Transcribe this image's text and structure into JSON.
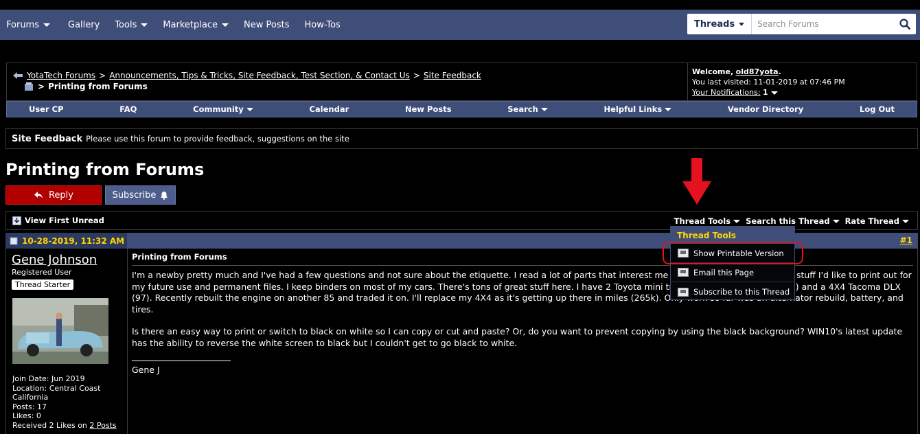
{
  "topnav": {
    "items": [
      {
        "label": "Forums",
        "dropdown": true
      },
      {
        "label": "Gallery",
        "dropdown": false
      },
      {
        "label": "Tools",
        "dropdown": true
      },
      {
        "label": "Marketplace",
        "dropdown": true
      },
      {
        "label": "New Posts",
        "dropdown": false
      },
      {
        "label": "How-Tos",
        "dropdown": false
      }
    ],
    "search_scope": "Threads",
    "search_placeholder": "Search Forums"
  },
  "breadcrumb": {
    "items": [
      "YotaTech Forums",
      "Announcements, Tips & Tricks, Site Feedback, Test Section, & Contact Us",
      "Site Feedback"
    ],
    "separator": ">",
    "current": "Printing from Forums"
  },
  "userbox": {
    "welcome": "Welcome,",
    "username": "old87yota",
    "last_visited": "You last visited: 11-01-2019 at 07:46 PM",
    "notifications_label": "Your Notifications:",
    "notifications_count": "1"
  },
  "subnav": {
    "items": [
      "User CP",
      "FAQ",
      "Community",
      "Calendar",
      "New Posts",
      "Search",
      "Helpful Links",
      "Vendor Directory",
      "Log Out"
    ]
  },
  "forum": {
    "name": "Site Feedback",
    "description": "Please use this forum to provide feedback, suggestions on the site"
  },
  "thread": {
    "title": "Printing from Forums",
    "reply_label": "Reply",
    "subscribe_label": "Subscribe"
  },
  "toolbar": {
    "view_first_unread": "View First Unread",
    "thread_tools": "Thread Tools",
    "search_thread": "Search this Thread",
    "rate_thread": "Rate Thread"
  },
  "dropdown": {
    "title": "Thread Tools",
    "items": [
      "Show Printable Version",
      "Email this Page",
      "Subscribe to this Thread"
    ]
  },
  "post": {
    "date": "10-28-2019, 11:32 AM",
    "number": "#1",
    "subject": "Printing from Forums",
    "paragraphs": [
      "I'm a newby pretty much and I've had a few questions and not sure about the etiquette. I read a lot of parts that interest me and sometimes come across stuff I'd like to print out for my future use and permanent files. I keep binders on most of my cars. There's tons of great stuff here. I have 2 Toyota mini trucks- one's a Dolphin RV (85) and a 4X4 Tacoma DLX (97). Recently rebuilt the engine on another 85 and traded it on. I'll replace my 4X4 as it's getting up there in miles (265k). Only work so far was an alternator rebuild, battery, and tires.",
      "Is there an easy way to print or switch to black on white so I can copy or cut and paste? Or, do you want to prevent copying by using the black background? WIN10's latest update has the ability to reverse the white screen to black but I couldn't get to go black to white."
    ],
    "signature": "Gene J"
  },
  "author": {
    "name": "Gene Johnson",
    "title": "Registered User",
    "badge": "Thread Starter",
    "join_date": "Join Date: Jun 2019",
    "location": "Location: Central Coast",
    "location2": "California",
    "posts": "Posts: 17",
    "likes": "Likes: 0",
    "received_prefix": "Received 2 Likes on",
    "received_link": "2 Posts"
  }
}
